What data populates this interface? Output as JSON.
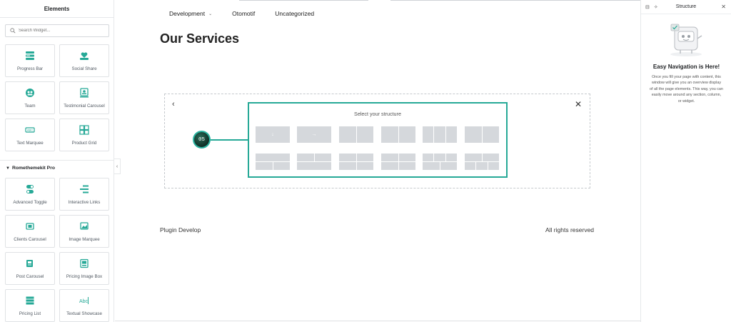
{
  "left_panel": {
    "title": "Elements",
    "search_placeholder": "Search Widget...",
    "widgets_top": [
      {
        "label": "Progress Bar",
        "icon": "progress-bar-icon"
      },
      {
        "label": "Social Share",
        "icon": "social-share-icon"
      },
      {
        "label": "Team",
        "icon": "team-icon"
      },
      {
        "label": "Testimonial Carousel",
        "icon": "testimonial-carousel-icon"
      },
      {
        "label": "Text Marquee",
        "icon": "text-marquee-icon"
      },
      {
        "label": "Product Grid",
        "icon": "product-grid-icon"
      }
    ],
    "section_title": "Romethemekit Pro",
    "widgets_pro": [
      {
        "label": "Advanced Toggle",
        "icon": "advanced-toggle-icon"
      },
      {
        "label": "Interactive Links",
        "icon": "interactive-links-icon"
      },
      {
        "label": "Clients Carousel",
        "icon": "clients-carousel-icon"
      },
      {
        "label": "Image Marquee",
        "icon": "image-marquee-icon"
      },
      {
        "label": "Post Carousel",
        "icon": "post-carousel-icon"
      },
      {
        "label": "Pricing Image Box",
        "icon": "pricing-image-box-icon"
      },
      {
        "label": "Pricing List",
        "icon": "pricing-list-icon"
      },
      {
        "label": "Textual Showcase",
        "icon": "textual-showcase-icon"
      }
    ],
    "accent_color": "#26a997"
  },
  "canvas": {
    "nav": [
      {
        "label": "Development",
        "has_dropdown": true
      },
      {
        "label": "Otomotif",
        "has_dropdown": false
      },
      {
        "label": "Uncategorized",
        "has_dropdown": false
      }
    ],
    "page_title": "Our Services",
    "structure": {
      "step_label": "05",
      "title": "Select your structure"
    },
    "footer_left": "Plugin Develop",
    "footer_right": "All rights reserved"
  },
  "right_panel": {
    "title": "Structure",
    "heading": "Easy Navigation is Here!",
    "text": "Once you fill your page with content, this window will give you an overview display of all the page elements. This way, you can easily move around any section, column, or widget."
  }
}
